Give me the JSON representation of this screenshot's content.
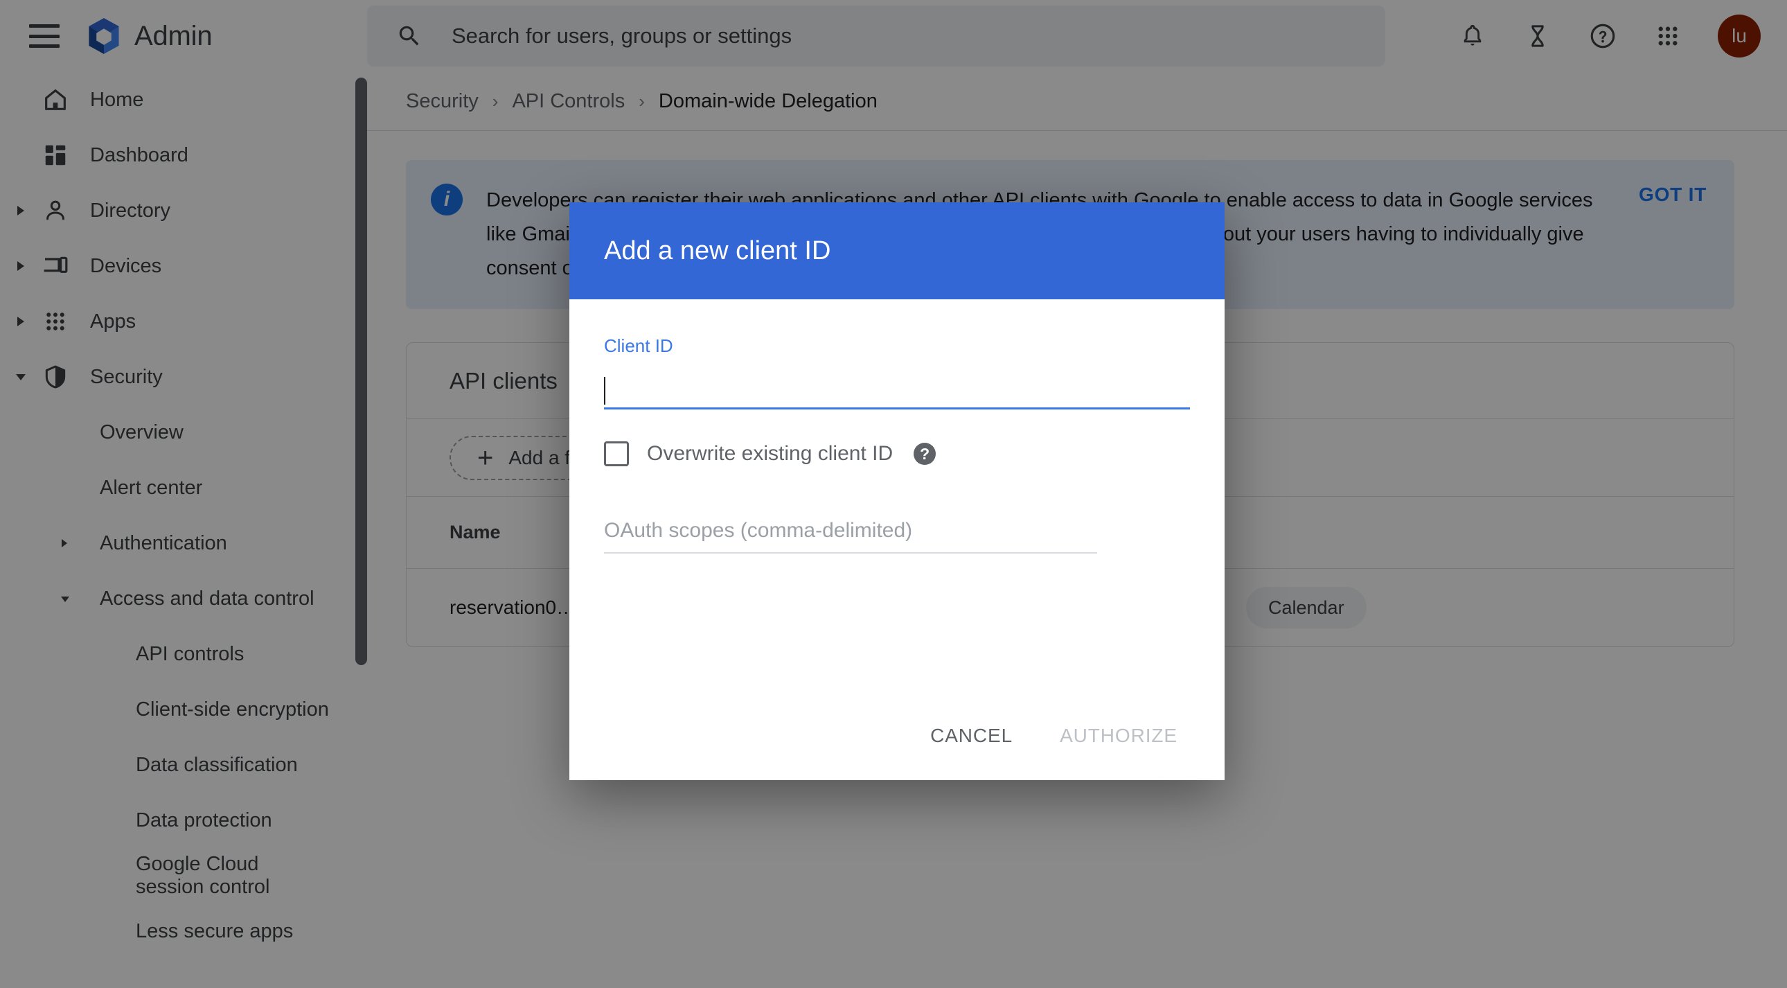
{
  "topbar": {
    "menu_icon": "hamburger-menu-icon",
    "logo_icon": "google-admin-logo-icon",
    "brand": "Admin",
    "search": {
      "icon": "search-icon",
      "placeholder": "Search for users, groups or settings",
      "value": ""
    },
    "actions": [
      {
        "icon": "notifications-bell-icon",
        "name": "notifications-button"
      },
      {
        "icon": "hourglass-icon",
        "name": "pending-tasks-button"
      },
      {
        "icon": "help-circle-icon",
        "name": "help-button"
      },
      {
        "icon": "apps-grid-icon",
        "name": "google-apps-button"
      }
    ],
    "avatar": {
      "initials": "lu",
      "color": "#8c2003"
    }
  },
  "sidebar": {
    "items": [
      {
        "label": "Home",
        "icon": "home-icon",
        "caret": "none",
        "level": 0
      },
      {
        "label": "Dashboard",
        "icon": "dashboard-icon",
        "caret": "none",
        "level": 0
      },
      {
        "label": "Directory",
        "icon": "person-icon",
        "caret": "right",
        "level": 0
      },
      {
        "label": "Devices",
        "icon": "devices-icon",
        "caret": "right",
        "level": 0
      },
      {
        "label": "Apps",
        "icon": "apps-grid-icon",
        "caret": "right",
        "level": 0
      },
      {
        "label": "Security",
        "icon": "shield-icon",
        "caret": "down",
        "level": 0
      }
    ],
    "sub_items": [
      {
        "label": "Overview",
        "caret": "none",
        "level": 1
      },
      {
        "label": "Alert center",
        "caret": "none",
        "level": 1
      },
      {
        "label": "Authentication",
        "caret": "right",
        "level": 1
      },
      {
        "label": "Access and data control",
        "caret": "down",
        "level": 1
      },
      {
        "label": "API controls",
        "caret": "none",
        "level": 2
      },
      {
        "label": "Client-side encryption",
        "caret": "none",
        "level": 2
      },
      {
        "label": "Data classification",
        "caret": "none",
        "level": 2
      },
      {
        "label": "Data protection",
        "caret": "none",
        "level": 2
      },
      {
        "label": "Google Cloud session control",
        "caret": "none",
        "level": 2
      },
      {
        "label": "Less secure apps",
        "caret": "none",
        "level": 2
      }
    ],
    "scrollbar": {
      "name": "sidebar-scrollbar-thumb"
    }
  },
  "breadcrumb": {
    "items": [
      "Security",
      "API Controls"
    ],
    "separator": "›",
    "current": "Domain-wide Delegation"
  },
  "banner": {
    "icon": "info-icon",
    "text": "Developers can register their web applications and other API clients with Google to enable access to data in Google services like Gmail. You can authorize these registered clients to access your user data without your users having to individually give consent or their passwords.",
    "action_label": "GOT IT",
    "accent": "#1a73e8",
    "background": "#e8f0fe"
  },
  "api_clients": {
    "title": "API clients",
    "filter_label": "Add a filter",
    "filter_icon": "plus-icon",
    "columns": [
      "Name"
    ],
    "rows": [
      {
        "name": "reservation0…",
        "scope_chip": "Calendar"
      }
    ]
  },
  "dialog": {
    "title": "Add a new client ID",
    "header_color": "#3367d6",
    "client_id": {
      "label": "Client ID",
      "value": "",
      "accent": "#3b78e7"
    },
    "overwrite": {
      "label": "Overwrite existing client ID",
      "checked": false,
      "help_icon": "help-circle-icon",
      "help_glyph": "?"
    },
    "scopes": {
      "placeholder": "OAuth scopes (comma-delimited)",
      "value": ""
    },
    "buttons": {
      "cancel": "CANCEL",
      "authorize": "AUTHORIZE",
      "authorize_disabled": true
    }
  }
}
